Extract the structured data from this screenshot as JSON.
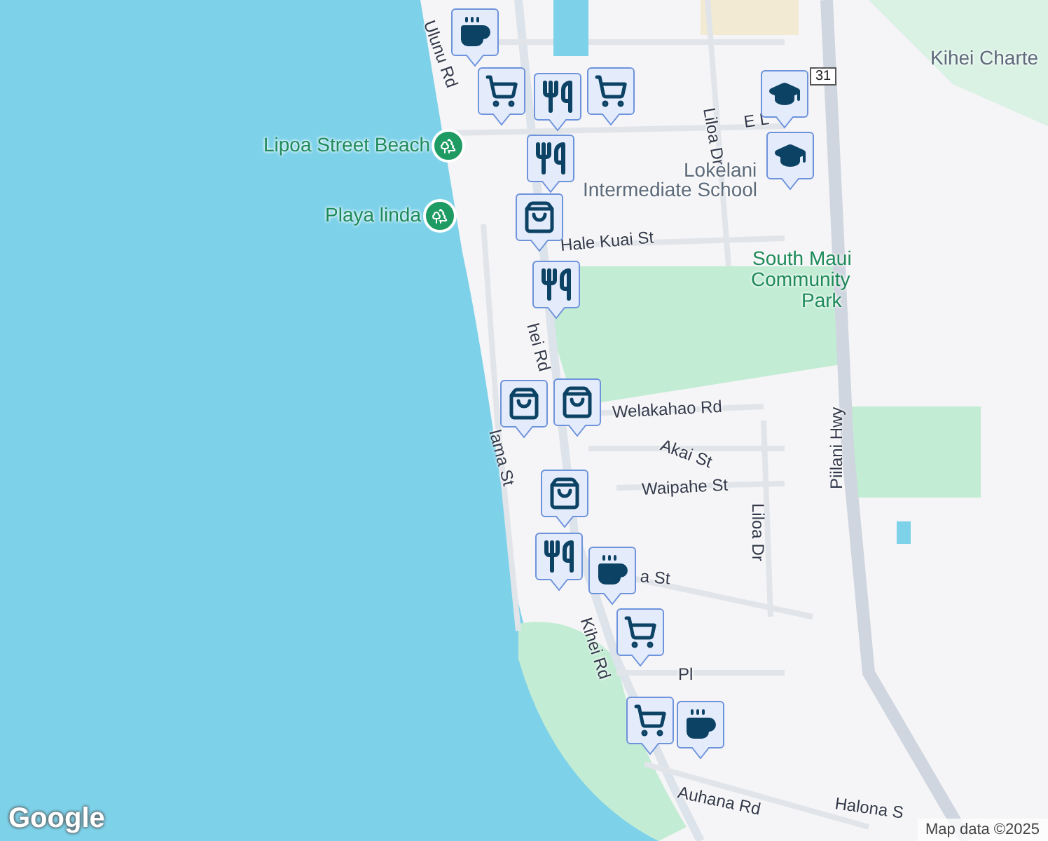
{
  "map": {
    "labels": [
      {
        "text": "Ulunu Rd",
        "kind": "street"
      },
      {
        "text": "Lipoa Street Beach",
        "kind": "park"
      },
      {
        "text": "Playa linda",
        "kind": "park"
      },
      {
        "text": "Liloa Dr",
        "kind": "street"
      },
      {
        "text": "E L",
        "kind": "street"
      },
      {
        "text": "Kihei Charte",
        "kind": "poi"
      },
      {
        "text": "Lokelani",
        "kind": "poi"
      },
      {
        "text": "Intermediate School",
        "kind": "poi"
      },
      {
        "text": "Hale Kuai St",
        "kind": "street"
      },
      {
        "text": "South Maui",
        "kind": "park"
      },
      {
        "text": "Community",
        "kind": "park"
      },
      {
        "text": "Park",
        "kind": "park"
      },
      {
        "text": "hei Rd",
        "kind": "street"
      },
      {
        "text": "Welakahao Rd",
        "kind": "street"
      },
      {
        "text": "Akai St",
        "kind": "street"
      },
      {
        "text": "Waipahe St",
        "kind": "street"
      },
      {
        "text": "Liloa Dr",
        "kind": "street"
      },
      {
        "text": "Piilani Hwy",
        "kind": "street"
      },
      {
        "text": "lama St",
        "kind": "street"
      },
      {
        "text": "a St",
        "kind": "street"
      },
      {
        "text": "Kihei Rd",
        "kind": "street"
      },
      {
        "text": "Pl",
        "kind": "street"
      },
      {
        "text": "Auhana Rd",
        "kind": "street"
      },
      {
        "text": "Halona S",
        "kind": "street"
      },
      {
        "text": "31",
        "kind": "shield"
      }
    ],
    "markers": [
      {
        "kind": "cafe"
      },
      {
        "kind": "grocery"
      },
      {
        "kind": "restaurant"
      },
      {
        "kind": "grocery"
      },
      {
        "kind": "restaurant"
      },
      {
        "kind": "shopping"
      },
      {
        "kind": "restaurant"
      },
      {
        "kind": "school"
      },
      {
        "kind": "school"
      },
      {
        "kind": "shopping"
      },
      {
        "kind": "shopping"
      },
      {
        "kind": "shopping"
      },
      {
        "kind": "restaurant"
      },
      {
        "kind": "cafe"
      },
      {
        "kind": "grocery"
      },
      {
        "kind": "grocery"
      },
      {
        "kind": "cafe"
      }
    ]
  },
  "attribution": {
    "logo": "Google",
    "text": "Map data ©2025"
  }
}
